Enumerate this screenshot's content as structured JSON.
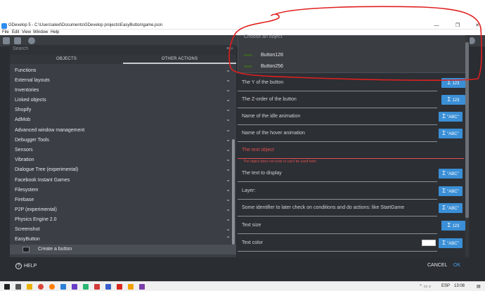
{
  "window": {
    "title": "GDevelop 5 - C:\\Users\\alexl\\Documents\\GDevelop projects\\EasyButton\\game.json",
    "controls": {
      "minimize": "—",
      "maximize": "❐",
      "close": "✕"
    }
  },
  "menubar": [
    "File",
    "Edit",
    "View",
    "Window",
    "Help"
  ],
  "left_panel": {
    "search_placeholder": "Search",
    "tabs": [
      "OBJECTS",
      "OTHER ACTIONS"
    ],
    "categories": [
      "Functions",
      "External layouts",
      "Inventories",
      "Linked objects",
      "Shopify",
      "AdMob",
      "Advanced window management",
      "Debugger Tools",
      "Sensors",
      "Vibration",
      "Dialogue Tree (experimental)",
      "Facebook Instant Games",
      "Filesystem",
      "Firebase",
      "P2P (experimental)",
      "Physics Engine 2.0",
      "Screenshot",
      "EasyButton"
    ],
    "subitem": "Create a button"
  },
  "right_panel": {
    "dropdown_ghost": "Choose an object",
    "dropdown_options": [
      "Button128",
      "Button256"
    ],
    "fields": [
      {
        "label": "The Y of the button",
        "button": "123"
      },
      {
        "label": "The Z-order of the button",
        "button": "123"
      },
      {
        "label": "Name of the idle animation",
        "button": "\"ABC\""
      },
      {
        "label": "Name of the hover animation",
        "button": "\"ABC\""
      },
      {
        "label": "The text object",
        "button": ""
      },
      {
        "label": "The text to display",
        "button": "\"ABC\""
      },
      {
        "label": "Layer:",
        "button": "\"ABC\""
      },
      {
        "label": "Some identifier to later check on conditions and do actions: like StartGame",
        "button": "\"ABC\""
      },
      {
        "label": "Text size",
        "button": "123"
      },
      {
        "label": "Text color",
        "button": "\"ABC\""
      }
    ],
    "error_text": "The object does not exist or can't be used here.",
    "sigma": "Σ"
  },
  "footer": {
    "help": "HELP",
    "cancel": "CANCEL",
    "ok": "OK"
  },
  "taskbar": {
    "language": "ESP",
    "time": "13:08"
  },
  "colors": {
    "accent": "#3b8fd6",
    "error": "#e05050",
    "annotation": "#e02020"
  }
}
